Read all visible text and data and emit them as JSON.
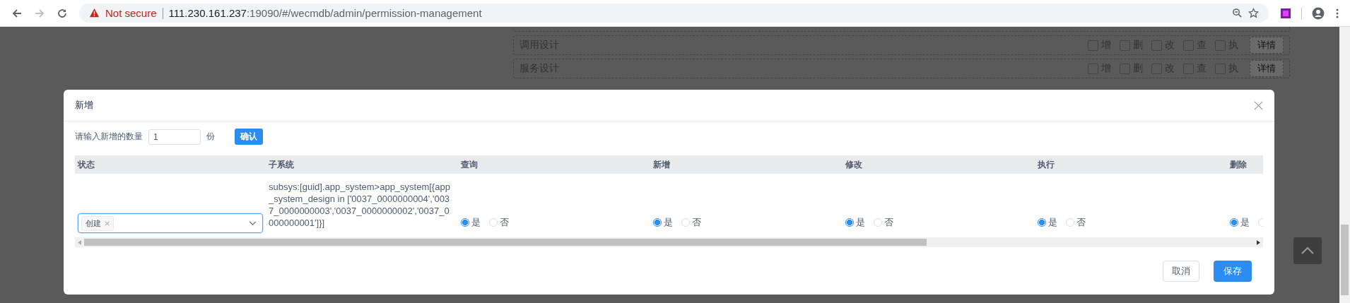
{
  "browser": {
    "security": "Not secure",
    "url_host": "111.230.161.237",
    "url_rest": ":19090/#/wecmdb/admin/permission-management"
  },
  "background_rows": [
    {
      "name": "调用设计",
      "permissions": [
        {
          "label": "增",
          "checked": false
        },
        {
          "label": "删",
          "checked": false
        },
        {
          "label": "改",
          "checked": false
        },
        {
          "label": "查",
          "checked": false
        },
        {
          "label": "执",
          "checked": false
        }
      ],
      "detail": "详情"
    },
    {
      "name": "服务设计",
      "permissions": [
        {
          "label": "增",
          "checked": false
        },
        {
          "label": "删",
          "checked": false
        },
        {
          "label": "改",
          "checked": false
        },
        {
          "label": "查",
          "checked": false
        },
        {
          "label": "执",
          "checked": false
        }
      ],
      "detail": "详情"
    }
  ],
  "dialog": {
    "title": "新增",
    "quantity_label": "请输入新增的数量",
    "quantity_value": "1",
    "quantity_unit": "份",
    "confirm_button": "确认",
    "columns": [
      "状态",
      "子系统",
      "查询",
      "新增",
      "修改",
      "执行",
      "删除"
    ],
    "rows": [
      {
        "status_tags": [
          "创建"
        ],
        "subsystem": "subsys:[guid].app_system>app_system[{app_system_design in ['0037_0000000004','0037_0000000003','0037_0000000002','0037_0000000001']}]",
        "permissions": [
          {
            "options": [
              {
                "label": "是",
                "selected": true
              },
              {
                "label": "否",
                "selected": false
              }
            ]
          },
          {
            "options": [
              {
                "label": "是",
                "selected": true
              },
              {
                "label": "否",
                "selected": false
              }
            ]
          },
          {
            "options": [
              {
                "label": "是",
                "selected": true
              },
              {
                "label": "否",
                "selected": false
              }
            ]
          },
          {
            "options": [
              {
                "label": "是",
                "selected": true
              },
              {
                "label": "否",
                "selected": false
              }
            ]
          },
          {
            "options": [
              {
                "label": "是",
                "selected": true
              },
              {
                "selected": false
              }
            ]
          }
        ]
      }
    ],
    "cancel_button": "取消",
    "save_button": "保存"
  }
}
